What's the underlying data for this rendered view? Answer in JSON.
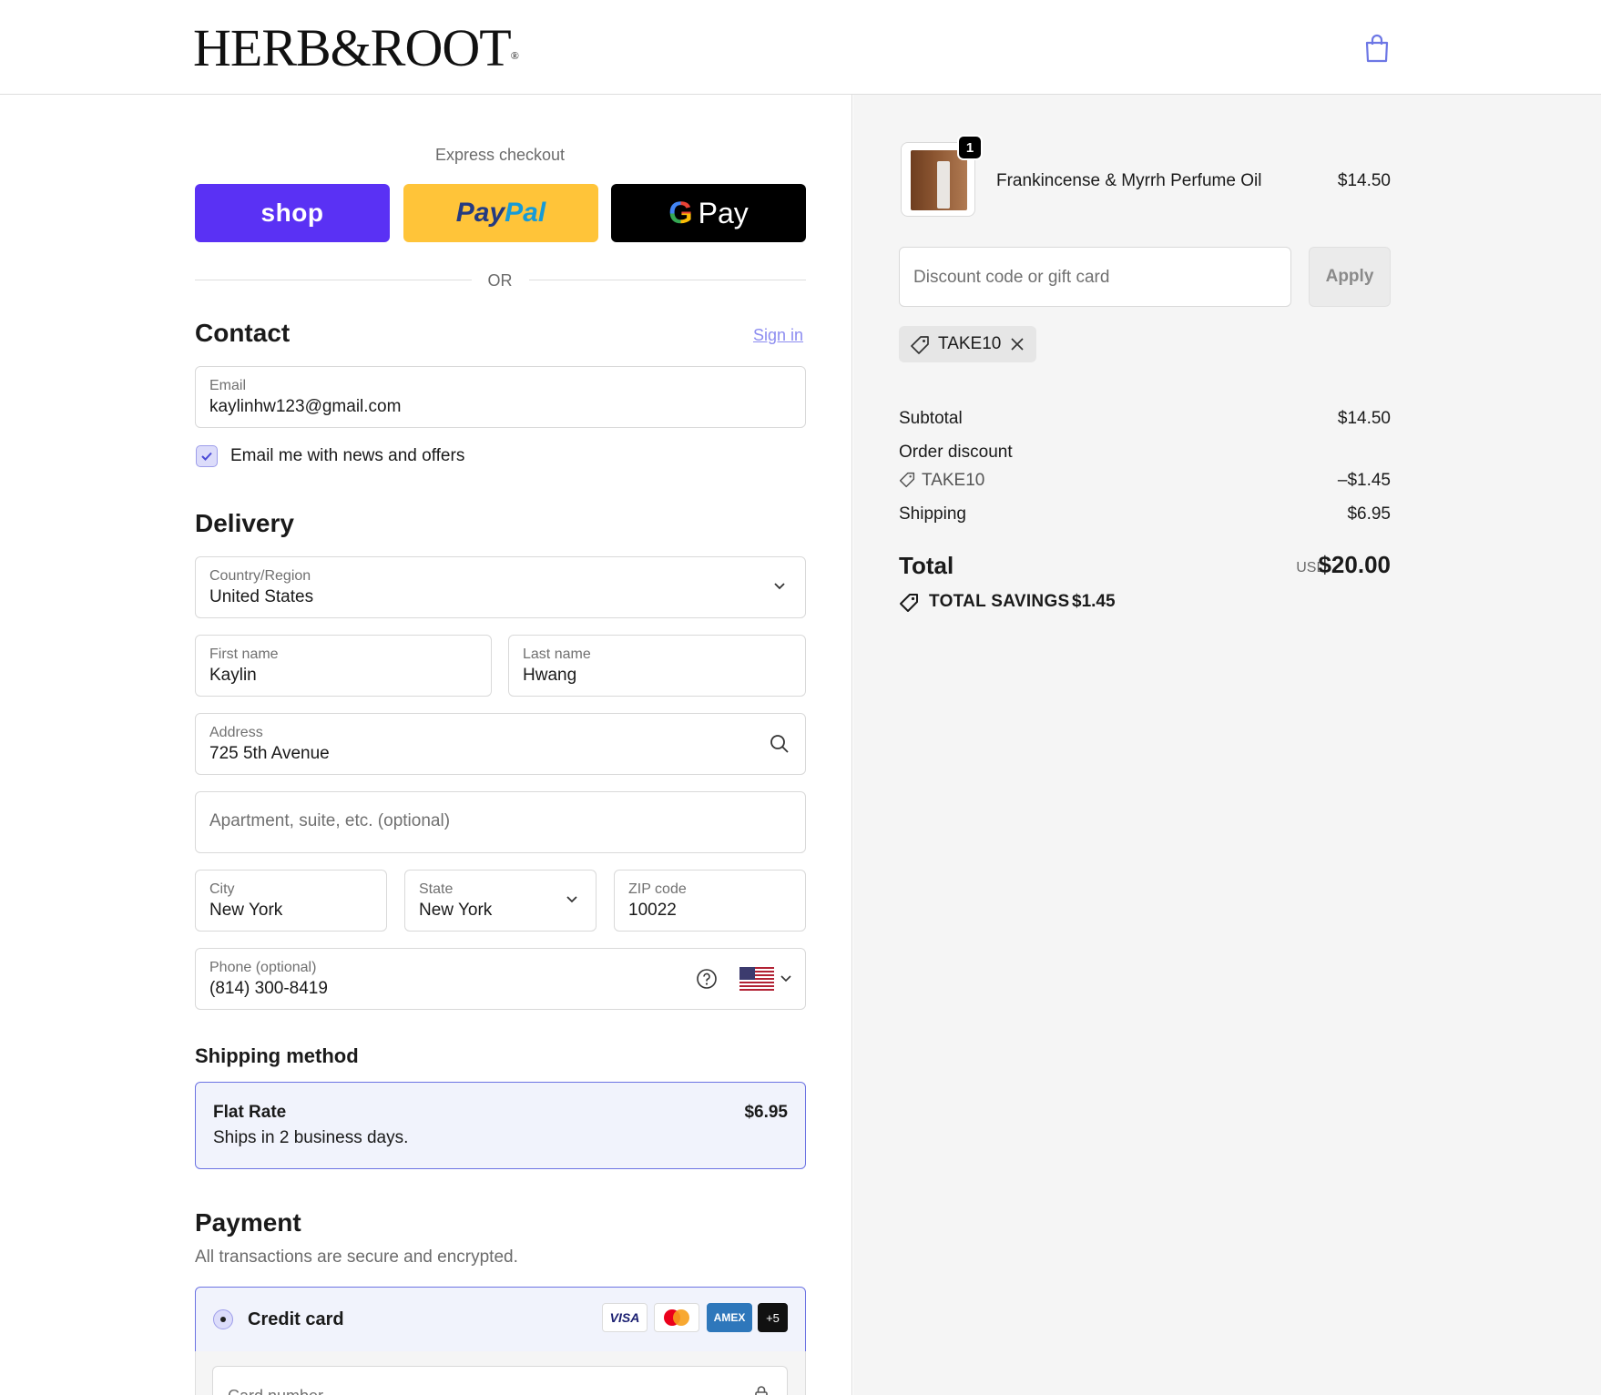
{
  "brand": {
    "logo_text": "HERB&ROOT",
    "logo_mark": "®"
  },
  "express": {
    "title": "Express checkout",
    "shop_label": "shop",
    "paypal_part1": "Pay",
    "paypal_part2": "Pal",
    "gpay_g": "G",
    "gpay_label": "Pay",
    "or_label": "OR"
  },
  "contact": {
    "heading": "Contact",
    "signin_label": "Sign in",
    "email_label": "Email",
    "email_value": "kaylinhw123@gmail.com",
    "newsletter_label": "Email me with news and offers",
    "newsletter_checked": true
  },
  "delivery": {
    "heading": "Delivery",
    "country_label": "Country/Region",
    "country_value": "United States",
    "first_name_label": "First name",
    "first_name_value": "Kaylin",
    "last_name_label": "Last name",
    "last_name_value": "Hwang",
    "address_label": "Address",
    "address_value": "725 5th Avenue",
    "apartment_placeholder": "Apartment, suite, etc. (optional)",
    "city_label": "City",
    "city_value": "New York",
    "state_label": "State",
    "state_value": "New York",
    "zip_label": "ZIP code",
    "zip_value": "10022",
    "phone_label": "Phone (optional)",
    "phone_value": "(814) 300-8419"
  },
  "shipping_method": {
    "heading": "Shipping method",
    "name": "Flat Rate",
    "description": "Ships in 2 business days.",
    "price": "$6.95"
  },
  "payment": {
    "heading": "Payment",
    "subtitle": "All transactions are secure and encrypted.",
    "method_label": "Credit card",
    "card_brands": [
      "VISA",
      "mastercard",
      "AMEX",
      "+5"
    ],
    "card_number_placeholder": "Card number"
  },
  "summary": {
    "item_name": "Frankincense & Myrrh Perfume Oil",
    "item_price": "$14.50",
    "item_qty": "1",
    "discount_placeholder": "Discount code or gift card",
    "apply_label": "Apply",
    "applied_code": "TAKE10",
    "subtotal_label": "Subtotal",
    "subtotal_value": "$14.50",
    "order_discount_label": "Order discount",
    "discount_code": "TAKE10",
    "discount_value": "–$1.45",
    "shipping_label": "Shipping",
    "shipping_value": "$6.95",
    "total_label": "Total",
    "currency": "USD",
    "total_value": "$20.00",
    "savings_label": "TOTAL SAVINGS",
    "savings_value": "$1.45"
  },
  "colors": {
    "shop_purple": "#5a31f4",
    "paypal_yellow": "#ffc439",
    "selection_blue": "#6c73e3",
    "link": "#8c8cf0"
  }
}
